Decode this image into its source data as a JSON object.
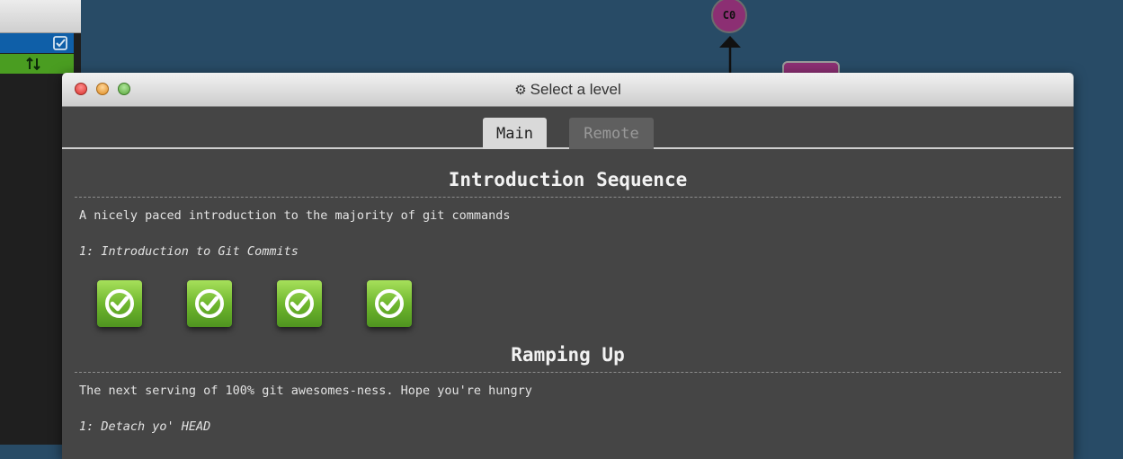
{
  "window": {
    "title": "Select a level",
    "title_icon": "gear-icon"
  },
  "tabs": [
    {
      "label": "Main",
      "active": true
    },
    {
      "label": "Remote",
      "active": false
    }
  ],
  "sequences": [
    {
      "title": "Introduction Sequence",
      "description": "A nicely paced introduction to the majority of git commands",
      "level_heading": "1: Introduction to Git Commits",
      "levels": [
        {
          "icon": "check-circle-icon",
          "completed": true
        },
        {
          "icon": "check-circle-icon",
          "completed": true
        },
        {
          "icon": "check-circle-icon",
          "completed": true
        },
        {
          "icon": "check-circle-icon",
          "completed": true
        }
      ]
    },
    {
      "title": "Ramping Up",
      "description": "The next serving of 100% git awesomes-ness. Hope you're hungry",
      "level_heading": "1: Detach yo' HEAD"
    }
  ],
  "graph": {
    "commit_label": "C0",
    "commit_color": "#8c2f73"
  },
  "sidebar": {
    "icons": [
      "checkbox-icon",
      "swap-arrows-icon"
    ]
  }
}
